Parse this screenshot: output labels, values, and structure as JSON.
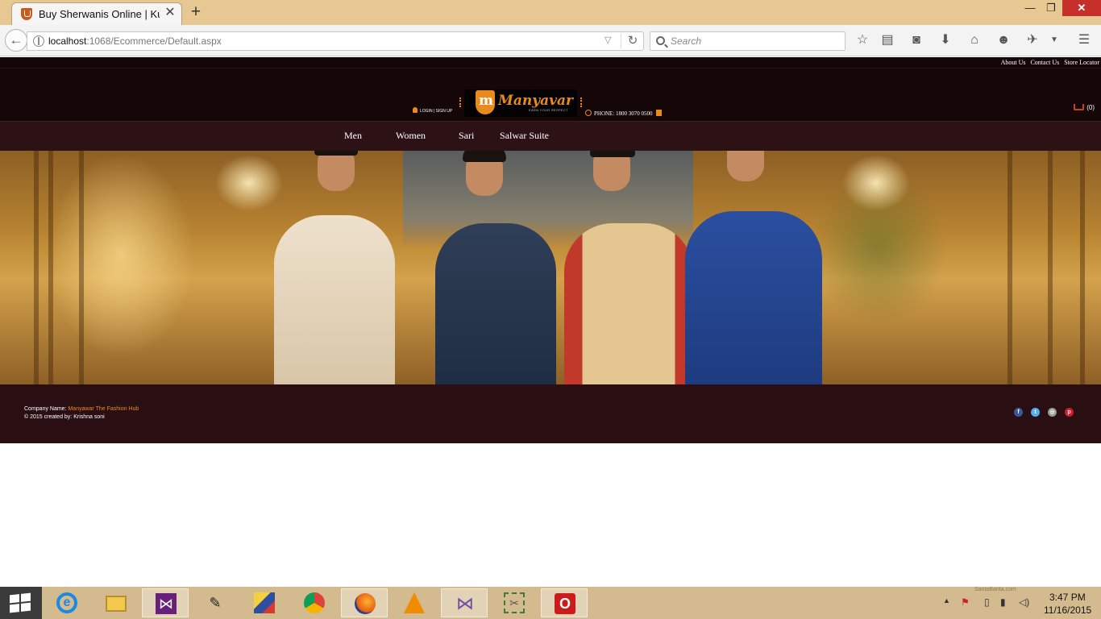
{
  "browser": {
    "tab_title": "Buy Sherwanis Online | Ku...",
    "url_host": "localhost",
    "url_rest": ":1068/Ecommerce/Default.aspx",
    "search_placeholder": "Search",
    "icons": [
      "bookmark-star-icon",
      "reading-list-icon",
      "pocket-icon",
      "download-icon",
      "home-icon",
      "chat-icon",
      "extension-icon",
      "menu-icon"
    ]
  },
  "site": {
    "top_links": [
      "About Us",
      "Contact Us",
      "Store Locator"
    ],
    "logo_text": "Manyavar",
    "logo_tagline": "EARN YOUR RESPECT",
    "login_text": "LOGIN | SIGN UP",
    "phone_text": "PHONE: 1800 3070 0500",
    "cart_text": "(0)",
    "nav": [
      "Men",
      "Women",
      "Sari",
      "Salwar Suite"
    ],
    "footer": {
      "company_label": "Company Name: ",
      "company_name": "Manyawar The Fashion Hub",
      "credit": "© 2015 created by: Krishna soni"
    },
    "social": [
      "facebook-icon",
      "twitter-icon",
      "instagram-icon",
      "pinterest-icon"
    ]
  },
  "taskbar": {
    "apps": [
      "internet-explorer-icon",
      "file-explorer-icon",
      "visual-studio-icon",
      "eyedropper-icon",
      "paint-app-icon",
      "chrome-icon",
      "firefox-icon",
      "vlc-icon",
      "vs-blend-icon",
      "snipping-tool-icon",
      "opera-icon"
    ],
    "time": "3:47 PM",
    "date": "11/16/2015",
    "watermark": "SantaBanta.com"
  },
  "colors": {
    "accent": "#e98a1d",
    "header_bg": "#150608",
    "nav_bg": "#2c1214",
    "footer_bg": "#2a0f12"
  }
}
